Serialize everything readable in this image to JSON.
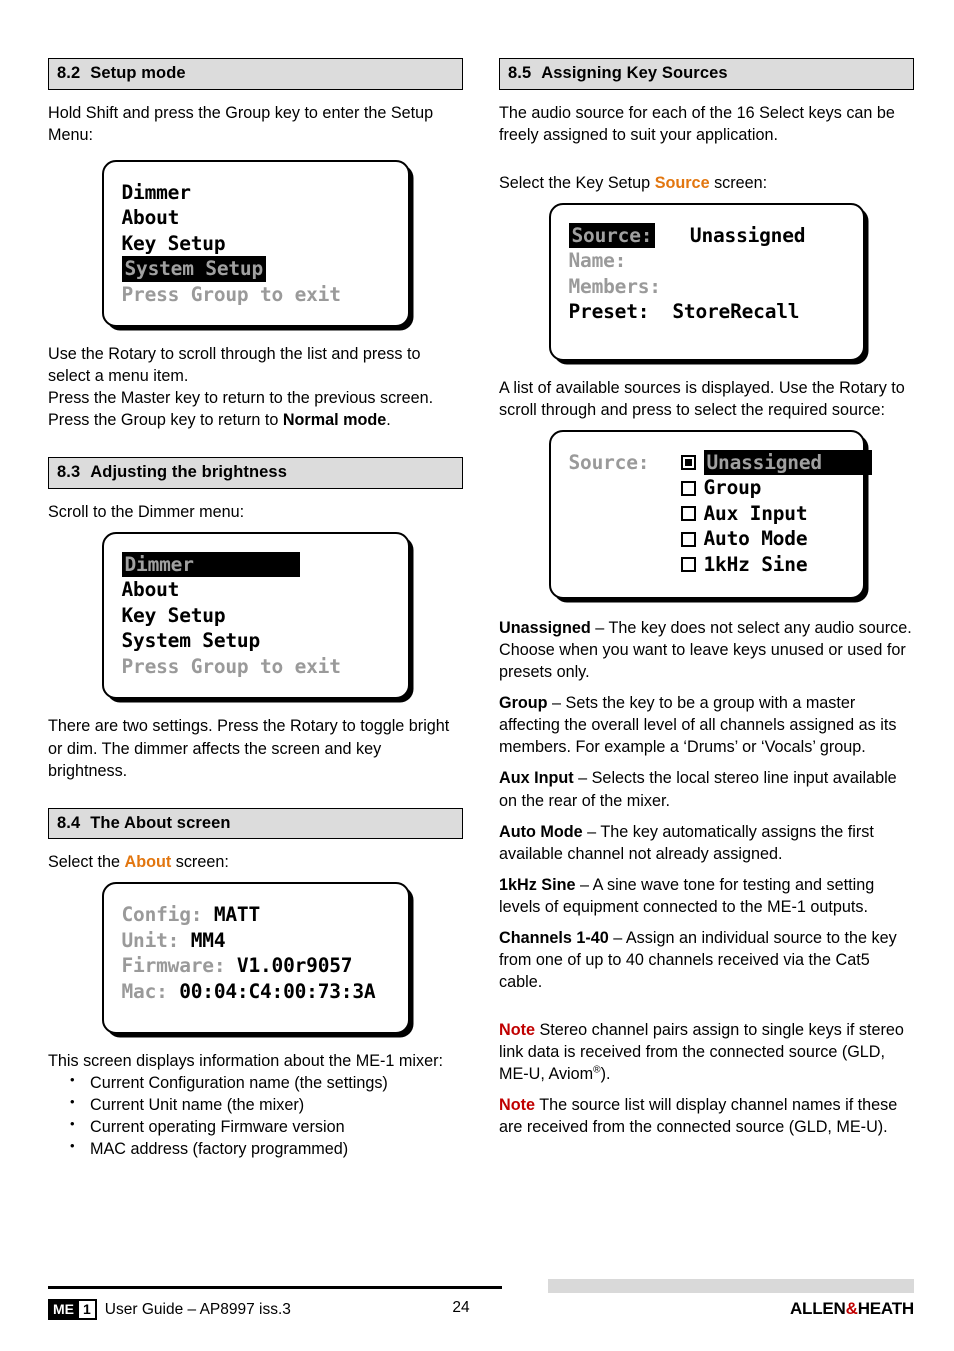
{
  "colors": {
    "accent_orange": "#e2760f",
    "note_red": "#c00000",
    "heading_bar": "#dcdcdc",
    "lcd_dim_text": "#9a9a9a"
  },
  "left_column": {
    "section_8_2": {
      "number": "8.2",
      "title": "Setup mode",
      "intro": "Hold Shift and press the Group key to enter the Setup Menu:",
      "lcd": {
        "name": "setup-menu-screen",
        "rows": [
          {
            "text": "Dimmer",
            "style": "normal"
          },
          {
            "text": "About",
            "style": "normal"
          },
          {
            "text": "Key Setup",
            "style": "normal"
          },
          {
            "text": "System Setup",
            "style": "highlight"
          },
          {
            "text": "Press Group to exit",
            "style": "dim"
          }
        ]
      },
      "after_1": "Use the Rotary to scroll through the list and press to select a menu item.",
      "after_2": "Press the Master key to return to the previous screen.",
      "after_3_pre": "Press the Group key to return to ",
      "after_3_bold": "Normal mode",
      "after_3_post": "."
    },
    "section_8_3": {
      "number": "8.3",
      "title": "Adjusting the brightness",
      "intro": "Scroll to the Dimmer menu:",
      "lcd": {
        "name": "dimmer-menu-screen",
        "rows": [
          {
            "text": "Dimmer",
            "style": "highlight-wide"
          },
          {
            "text": "About",
            "style": "normal"
          },
          {
            "text": "Key Setup",
            "style": "normal"
          },
          {
            "text": "System Setup",
            "style": "normal"
          },
          {
            "text": "Press Group to exit",
            "style": "dim"
          }
        ]
      },
      "after": "There are two settings. Press the Rotary to toggle bright or dim. The dimmer affects the screen and key brightness."
    },
    "section_8_4": {
      "number": "8.4",
      "title": "The About screen",
      "intro_pre": "Select the ",
      "intro_accent": "About",
      "intro_post": " screen:",
      "lcd": {
        "name": "about-screen",
        "rows": [
          {
            "label": "Config:",
            "value": "MATT"
          },
          {
            "label": "Unit:",
            "value": "MM4"
          },
          {
            "label": "Firmware:",
            "value": "V1.00r9057"
          },
          {
            "label": "Mac:",
            "value": "00:04:C4:00:73:3A"
          }
        ]
      },
      "after": "This screen displays information about the ME-1 mixer:",
      "bullets": [
        "Current Configuration name (the settings)",
        "Current Unit name (the mixer)",
        "Current operating Firmware version",
        "MAC address (factory programmed)"
      ]
    }
  },
  "right_column": {
    "section_8_5": {
      "number": "8.5",
      "title": "Assigning Key Sources",
      "intro": "The audio source for each of the 16 Select keys can be freely assigned to suit your application.",
      "select_pre": "Select the Key Setup ",
      "select_accent": "Source",
      "select_post": " screen:",
      "lcd_key_setup": {
        "name": "key-setup-source-screen",
        "rows": [
          {
            "label": "Source:",
            "value": "Unassigned",
            "style": "highlight"
          },
          {
            "label": "Name:",
            "value": "",
            "style": "dim"
          },
          {
            "label": "Members:",
            "value": "",
            "style": "dim"
          },
          {
            "label": "Preset:",
            "value": "StoreRecall",
            "style": "normal"
          }
        ]
      },
      "list_intro": "A list of available sources is displayed. Use the Rotary to scroll through and press to select the required source:",
      "lcd_source_list": {
        "name": "source-list-screen",
        "label": "Source:",
        "options": [
          {
            "label": "Unassigned",
            "checked": true,
            "highlight": true
          },
          {
            "label": "Group",
            "checked": false,
            "highlight": false
          },
          {
            "label": "Aux Input",
            "checked": false,
            "highlight": false
          },
          {
            "label": "Auto Mode",
            "checked": false,
            "highlight": false
          },
          {
            "label": "1kHz Sine",
            "checked": false,
            "highlight": false
          }
        ]
      },
      "definitions": [
        {
          "term": "Unassigned",
          "text": " – The key does not select any audio source. Choose when you want to leave keys unused or used for presets only."
        },
        {
          "term": "Group",
          "text": " – Sets the key to be a group with a master affecting the overall level of all channels assigned as its members. For example a ‘Drums’  or ‘Vocals’ group."
        },
        {
          "term": "Aux Input",
          "text": " – Selects the local stereo line input available on the rear of the mixer."
        },
        {
          "term": "Auto Mode",
          "text": " – The key automatically assigns the first available channel not already assigned."
        },
        {
          "term": "1kHz Sine",
          "text": " – A sine wave tone for testing and setting levels of equipment connected to the ME-1 outputs."
        },
        {
          "term": "Channels 1-40",
          "text": " – Assign an individual source to the key from one of up to 40 channels received via the Cat5 cable."
        }
      ],
      "notes": [
        {
          "label": "Note",
          "text_pre": "  Stereo channel pairs assign to single keys if stereo link data is received from the connected source (GLD, ME-U, Aviom",
          "sup": "®",
          "text_post": ")."
        },
        {
          "label": "Note",
          "text_pre": "  The source list will display channel names if these are received from the connected source (GLD, ME-U).",
          "sup": "",
          "text_post": ""
        }
      ]
    }
  },
  "footer": {
    "logo_me": "ME",
    "logo_one": "1",
    "title": "User Guide – AP8997 iss.3",
    "page_number": "24",
    "brand_left": "ALLEN",
    "brand_amp": "&",
    "brand_right": "HEATH"
  }
}
